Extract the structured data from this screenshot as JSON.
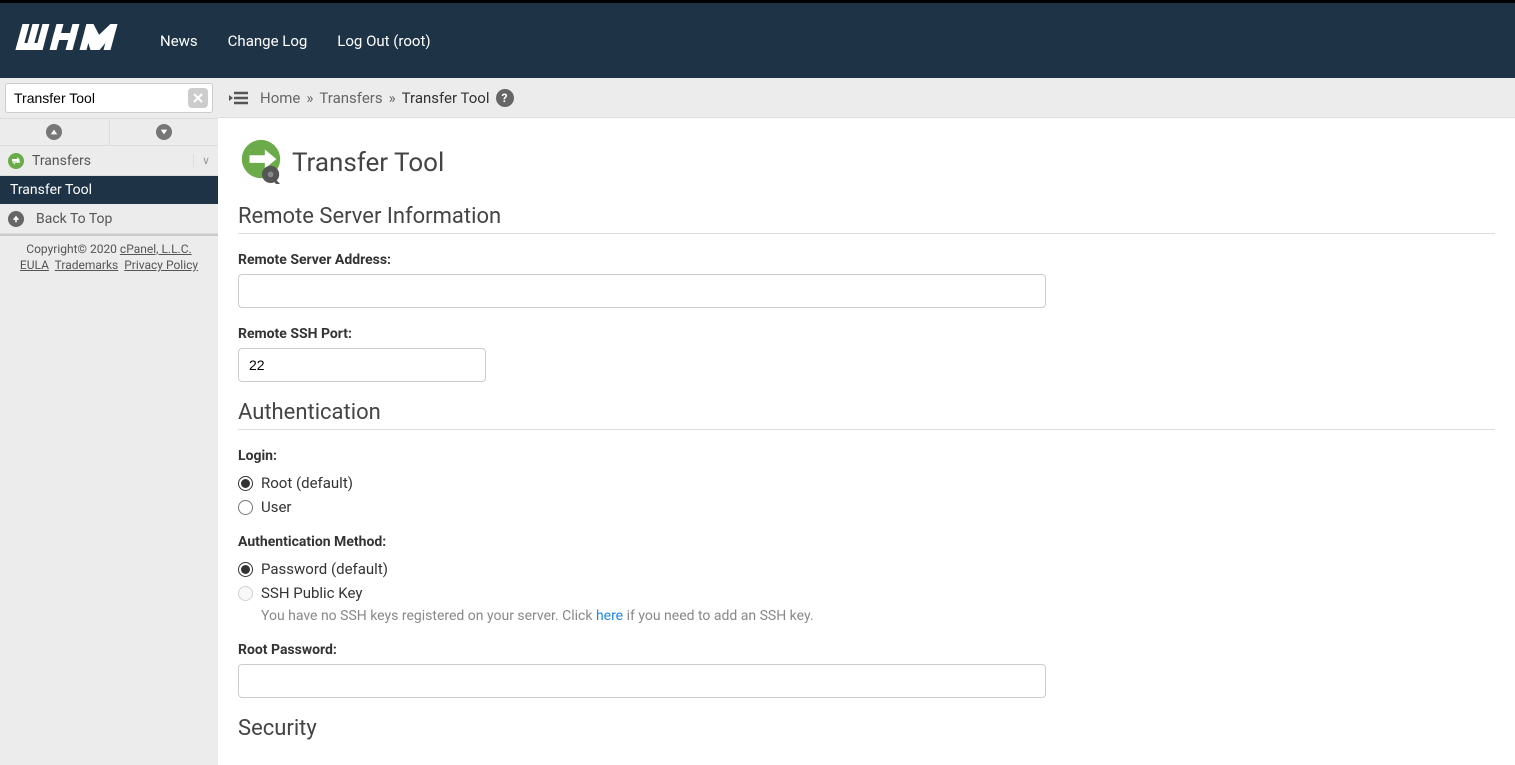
{
  "header": {
    "nav": {
      "news": "News",
      "changelog": "Change Log",
      "logout": "Log Out (root)"
    }
  },
  "sidebar": {
    "search_value": "Transfer Tool",
    "section_transfers": "Transfers",
    "item_transfer_tool": "Transfer Tool",
    "back_to_top": "Back To Top",
    "footer_copyright": "Copyright© 2020 ",
    "footer_cpanel": "cPanel, L.L.C.",
    "footer_eula": "EULA",
    "footer_trademarks": "Trademarks",
    "footer_privacy": "Privacy Policy"
  },
  "breadcrumb": {
    "home": "Home",
    "transfers": "Transfers",
    "current": "Transfer Tool"
  },
  "page": {
    "title": "Transfer Tool",
    "section_remote": "Remote Server Information",
    "label_address": "Remote Server Address:",
    "value_address": "",
    "label_ssh_port": "Remote SSH Port:",
    "value_ssh_port": "22",
    "section_auth": "Authentication",
    "label_login": "Login:",
    "radio_root": "Root (default)",
    "radio_user": "User",
    "label_auth_method": "Authentication Method:",
    "radio_password": "Password (default)",
    "radio_ssh_key": "SSH Public Key",
    "ssh_help_prefix": "You have no SSH keys registered on your server. Click ",
    "ssh_help_link": "here",
    "ssh_help_suffix": " if you need to add an SSH key.",
    "label_root_password": "Root Password:",
    "value_root_password": "",
    "section_security": "Security"
  }
}
